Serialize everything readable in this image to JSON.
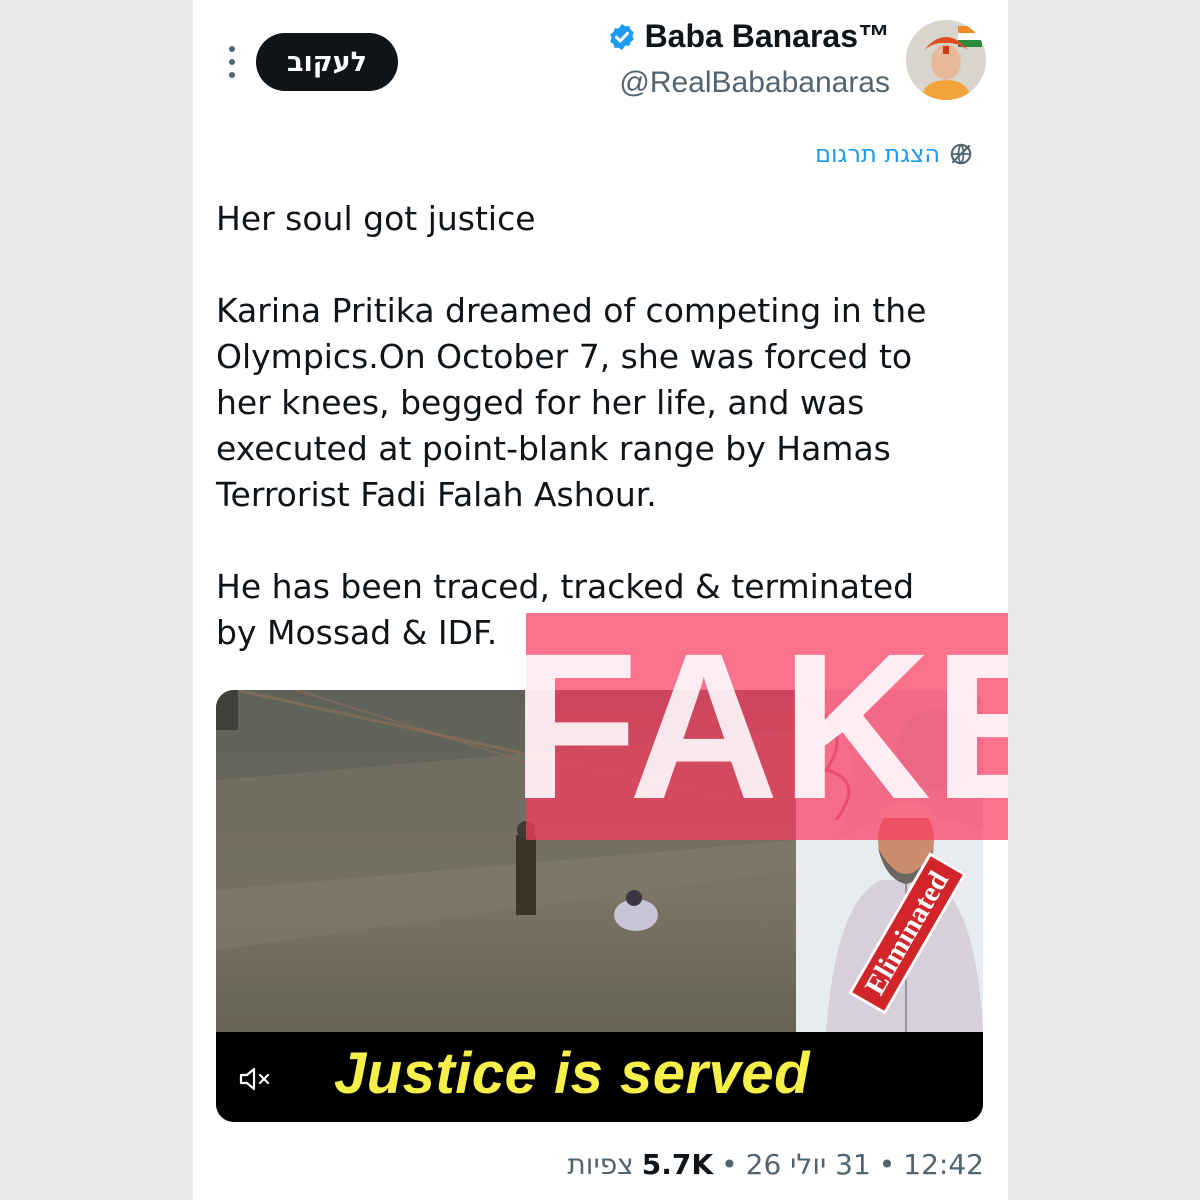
{
  "header": {
    "follow_label": "לעקוב",
    "author_name": "Baba Banaras™",
    "author_handle": "@RealBababanaras"
  },
  "translate_label": "הצגת תרגום",
  "tweet": {
    "text": "Her soul got justice\n\nKarina Pritika dreamed of competing in the\nOlympics.On October 7, she was forced to\nher knees, begged for her life, and was\nexecuted at point-blank range by Hamas\nTerrorist Fadi Falah Ashour.\n\nHe has been traced, tracked & terminated\nby Mossad & IDF."
  },
  "media": {
    "caption": "Justice is served",
    "badge": "Eliminated"
  },
  "meta": {
    "time": "12:42",
    "date": "31 יולי 26",
    "views_count": "5.7K",
    "views_label": "צפיות",
    "separator": "•"
  },
  "stamp": "FAKE",
  "colors": {
    "accent": "#1d9bf0",
    "stamp": "#fa3c5f",
    "caption": "#f7f04a"
  },
  "icons": [
    "more-icon",
    "verified-badge-icon",
    "translate-icon",
    "mute-icon"
  ]
}
